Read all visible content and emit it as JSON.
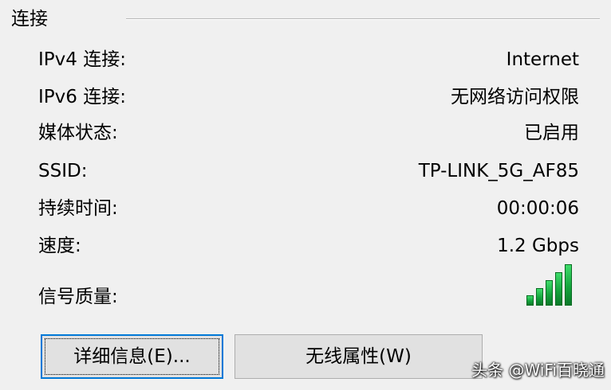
{
  "group": {
    "title": "连接"
  },
  "rows": [
    {
      "label": "IPv4 连接:",
      "value": "Internet"
    },
    {
      "label": "IPv6 连接:",
      "value": "无网络访问权限"
    },
    {
      "label": "媒体状态:",
      "value": "已启用"
    },
    {
      "label": "SSID:",
      "value": "TP-LINK_5G_AF85"
    },
    {
      "label": "持续时间:",
      "value": "00:00:06"
    },
    {
      "label": "速度:",
      "value": "1.2 Gbps"
    }
  ],
  "signal": {
    "label": "信号质量:",
    "icon": "signal-strength-icon",
    "bars_filled": 5,
    "bars_total": 5,
    "color": "#14a43c"
  },
  "buttons": {
    "details": "详细信息(E)...",
    "wireless_properties": "无线属性(W)"
  },
  "watermark": "头条 @WiFi百晓通"
}
